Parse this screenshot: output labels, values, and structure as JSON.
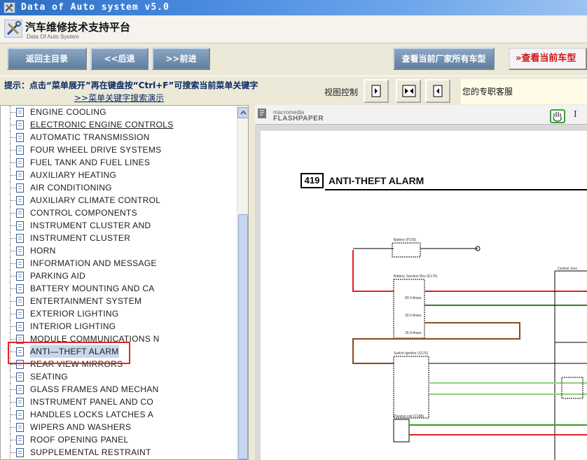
{
  "window": {
    "title": "Data of Auto system v5.0"
  },
  "header": {
    "title": "汽车维修技术支持平台",
    "subtitle": "Data Of Auto System"
  },
  "toolbar": {
    "home": "返回主目录",
    "back": "<<后退",
    "forward": ">>前进",
    "all_models": "查看当前厂家所有车型",
    "current_model": "查看当前车型"
  },
  "hint": {
    "text": "提示：点击“菜单展开”再在键盘按“Ctrl+F”可搜索当前菜单关键字",
    "link": ">>菜单关键字搜索演示"
  },
  "view_control": {
    "label": "视图控制"
  },
  "support": {
    "text": "您的专职客服"
  },
  "tree": {
    "items": [
      {
        "label": "ENGINE COOLING"
      },
      {
        "label": "ELECTRONIC ENGINE CONTROLS"
      },
      {
        "label": "AUTOMATIC TRANSMISSION"
      },
      {
        "label": "FOUR WHEEL DRIVE SYSTEMS"
      },
      {
        "label": "FUEL TANK AND FUEL LINES"
      },
      {
        "label": "AUXILIARY HEATING"
      },
      {
        "label": "AIR CONDITIONING"
      },
      {
        "label": "AUXILIARY CLIMATE CONTROL"
      },
      {
        "label": "CONTROL COMPONENTS"
      },
      {
        "label": "INSTRUMENT CLUSTER AND"
      },
      {
        "label": "INSTRUMENT CLUSTER"
      },
      {
        "label": "HORN"
      },
      {
        "label": "INFORMATION AND MESSAGE"
      },
      {
        "label": "PARKING AID"
      },
      {
        "label": "BATTERY MOUNTING AND CA"
      },
      {
        "label": "ENTERTAINMENT SYSTEM"
      },
      {
        "label": "EXTERIOR LIGHTING"
      },
      {
        "label": "INTERIOR LIGHTING"
      },
      {
        "label": "MODULE COMMUNICATIONS N"
      },
      {
        "label": "ANTI—THEFT ALARM"
      },
      {
        "label": "REAR VIEW MIRRORS"
      },
      {
        "label": "SEATING"
      },
      {
        "label": "GLASS FRAMES AND MECHAN"
      },
      {
        "label": "INSTRUMENT PANEL AND CO"
      },
      {
        "label": "HANDLES LOCKS LATCHES A"
      },
      {
        "label": "WIPERS AND WASHERS"
      },
      {
        "label": "ROOF OPENING PANEL"
      },
      {
        "label": "SUPPLEMENTAL RESTRAINT"
      }
    ]
  },
  "viewer": {
    "brand_small": "macromedia",
    "brand_name": "FLASHPAPER",
    "text_tool": "I",
    "document": {
      "number": "419",
      "title": "ANTI-THEFT ALARM",
      "labels": {
        "battery": "Battery (P155)",
        "bjb": "Battery Junction Box (E175)",
        "switch": "Switch-Ignition (S176)",
        "passive": "Passive coil (C188)",
        "central": "Central Junc",
        "fuse1": "60.0 Amps",
        "fuse2": "30.0 Amps",
        "fuse3": "25.0 Amps"
      }
    }
  },
  "colors": {
    "accent_red": "#d0121b",
    "wire_red": "#e31e24",
    "wire_green": "#3c9a2b",
    "wire_brown": "#8b4a1f",
    "wire_lightgreen": "#8ed07b"
  }
}
